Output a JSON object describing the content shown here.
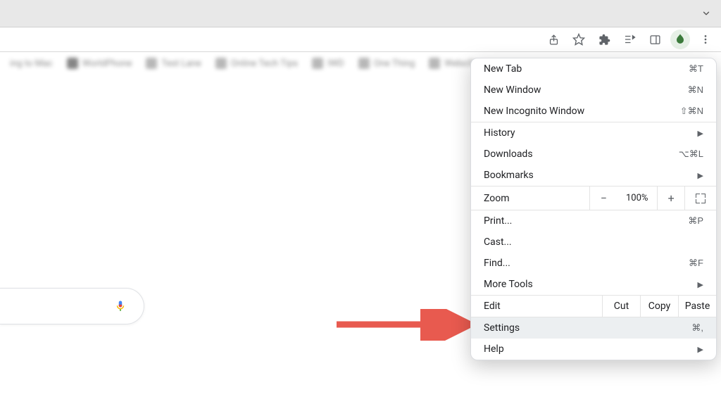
{
  "bookmarks": [
    "ing to Mac",
    "WorldPhone",
    "Test Lane",
    "Online Tech Tips",
    "IWD",
    "One Thing",
    "WeboSt"
  ],
  "menu": {
    "new_tab": {
      "label": "New Tab",
      "shortcut": "⌘T"
    },
    "new_window": {
      "label": "New Window",
      "shortcut": "⌘N"
    },
    "new_incognito": {
      "label": "New Incognito Window",
      "shortcut": "⇧⌘N"
    },
    "history": {
      "label": "History"
    },
    "downloads": {
      "label": "Downloads",
      "shortcut": "⌥⌘L"
    },
    "bookmarks": {
      "label": "Bookmarks"
    },
    "zoom": {
      "label": "Zoom",
      "value": "100%"
    },
    "print": {
      "label": "Print...",
      "shortcut": "⌘P"
    },
    "cast": {
      "label": "Cast..."
    },
    "find": {
      "label": "Find...",
      "shortcut": "⌘F"
    },
    "more_tools": {
      "label": "More Tools"
    },
    "edit": {
      "label": "Edit",
      "cut": "Cut",
      "copy": "Copy",
      "paste": "Paste"
    },
    "settings": {
      "label": "Settings",
      "shortcut": "⌘,"
    },
    "help": {
      "label": "Help"
    }
  }
}
